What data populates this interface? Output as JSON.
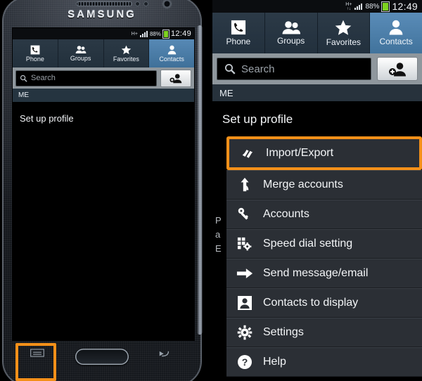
{
  "status_bar": {
    "network": "H+",
    "network_sub": "↑↓",
    "battery_percent": "88%",
    "time": "12:49"
  },
  "tabs": [
    {
      "label": "Phone",
      "icon": "phone-icon",
      "active": false
    },
    {
      "label": "Groups",
      "icon": "groups-icon",
      "active": false
    },
    {
      "label": "Favorites",
      "icon": "star-icon",
      "active": false
    },
    {
      "label": "Contacts",
      "icon": "contact-icon",
      "active": true
    }
  ],
  "search": {
    "placeholder": "Search",
    "value": "",
    "icon": "search-icon",
    "add_contact_icon": "add-contact-icon"
  },
  "list_header": "ME",
  "profile_item": "Set up profile",
  "menu": {
    "items": [
      {
        "label": "Import/Export",
        "icon": "import-export-icon",
        "highlighted": true
      },
      {
        "label": "Merge accounts",
        "icon": "merge-arrow-icon",
        "highlighted": false
      },
      {
        "label": "Accounts",
        "icon": "key-icon",
        "highlighted": false
      },
      {
        "label": "Speed dial setting",
        "icon": "keypad-gear-icon",
        "highlighted": false
      },
      {
        "label": "Send message/email",
        "icon": "right-arrow-icon",
        "highlighted": false
      },
      {
        "label": "Contacts to display",
        "icon": "contact-card-icon",
        "highlighted": false
      },
      {
        "label": "Settings",
        "icon": "gear-icon",
        "highlighted": false
      },
      {
        "label": "Help",
        "icon": "help-icon",
        "highlighted": false
      }
    ],
    "occluded_text": [
      "P",
      "a",
      "E"
    ]
  },
  "phone": {
    "brand": "SAMSUNG",
    "hardware_keys": {
      "menu": "menu-key",
      "home": "home-key",
      "back": "back-key"
    }
  },
  "colors": {
    "highlight": "#f49019",
    "tab_active": "#4a7ba5",
    "tab_inactive": "#26343f",
    "menu_row": "#2b2f35",
    "search_bar": "#8f979d",
    "battery": "#7ed321"
  }
}
